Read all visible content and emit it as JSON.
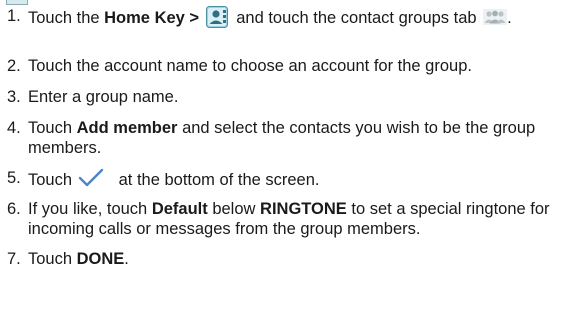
{
  "steps": [
    {
      "number": "1.",
      "parts": {
        "a": "Touch the ",
        "b": "Home Key > ",
        "c": " and touch the contact groups tab ",
        "d": "."
      }
    },
    {
      "number": "2.",
      "text": "Touch the account name to choose an account for the group."
    },
    {
      "number": "3.",
      "text": "Enter a group name."
    },
    {
      "number": "4.",
      "parts": {
        "a": "Touch ",
        "b": "Add member",
        "c": " and select the contacts you wish to be the group members."
      }
    },
    {
      "number": "5.",
      "parts": {
        "a": "Touch",
        "b": " at the bottom of the screen."
      }
    },
    {
      "number": "6.",
      "parts": {
        "a": "If you like, touch ",
        "b": "Default",
        "c": " below ",
        "d": "RINGTONE",
        "e": " to set a special ringtone for incoming calls or messages from the group members."
      }
    },
    {
      "number": "7.",
      "parts": {
        "a": "Touch ",
        "b": "DONE",
        "c": "."
      }
    }
  ],
  "icons": {
    "contacts_app": "contacts-app-icon",
    "contact_groups_tab": "contact-groups-tab-icon",
    "done_check": "checkmark-icon"
  },
  "colors": {
    "heading": "#e0007a",
    "text": "#1a1a1a",
    "check": "#4a86c8"
  }
}
